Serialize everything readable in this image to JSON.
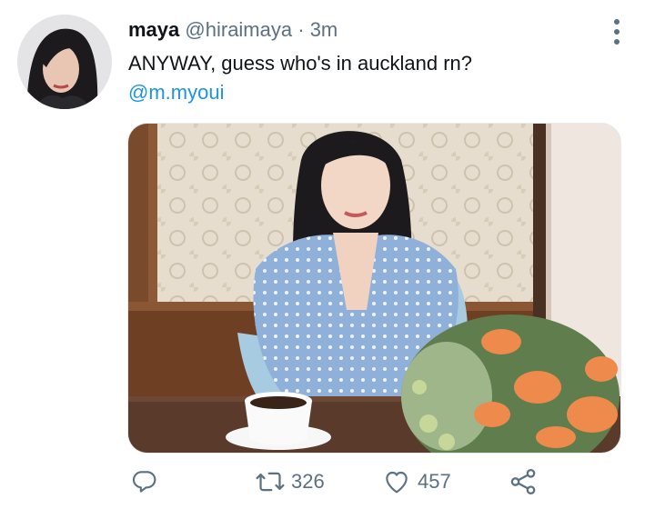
{
  "tweet": {
    "display_name": "maya",
    "handle": "@hiraimaya",
    "separator": "·",
    "time": "3m",
    "text": "ANYWAY, guess who's in auckland rn?",
    "mention": "@m.myoui",
    "actions": {
      "reply_count": "",
      "retweet_count": "326",
      "like_count": "457"
    }
  },
  "colors": {
    "link": "#1b95e0",
    "secondary_text": "#5b7083",
    "primary_text": "#0f1419"
  },
  "icons": [
    "more-icon",
    "reply-icon",
    "retweet-icon",
    "like-icon",
    "share-icon"
  ]
}
